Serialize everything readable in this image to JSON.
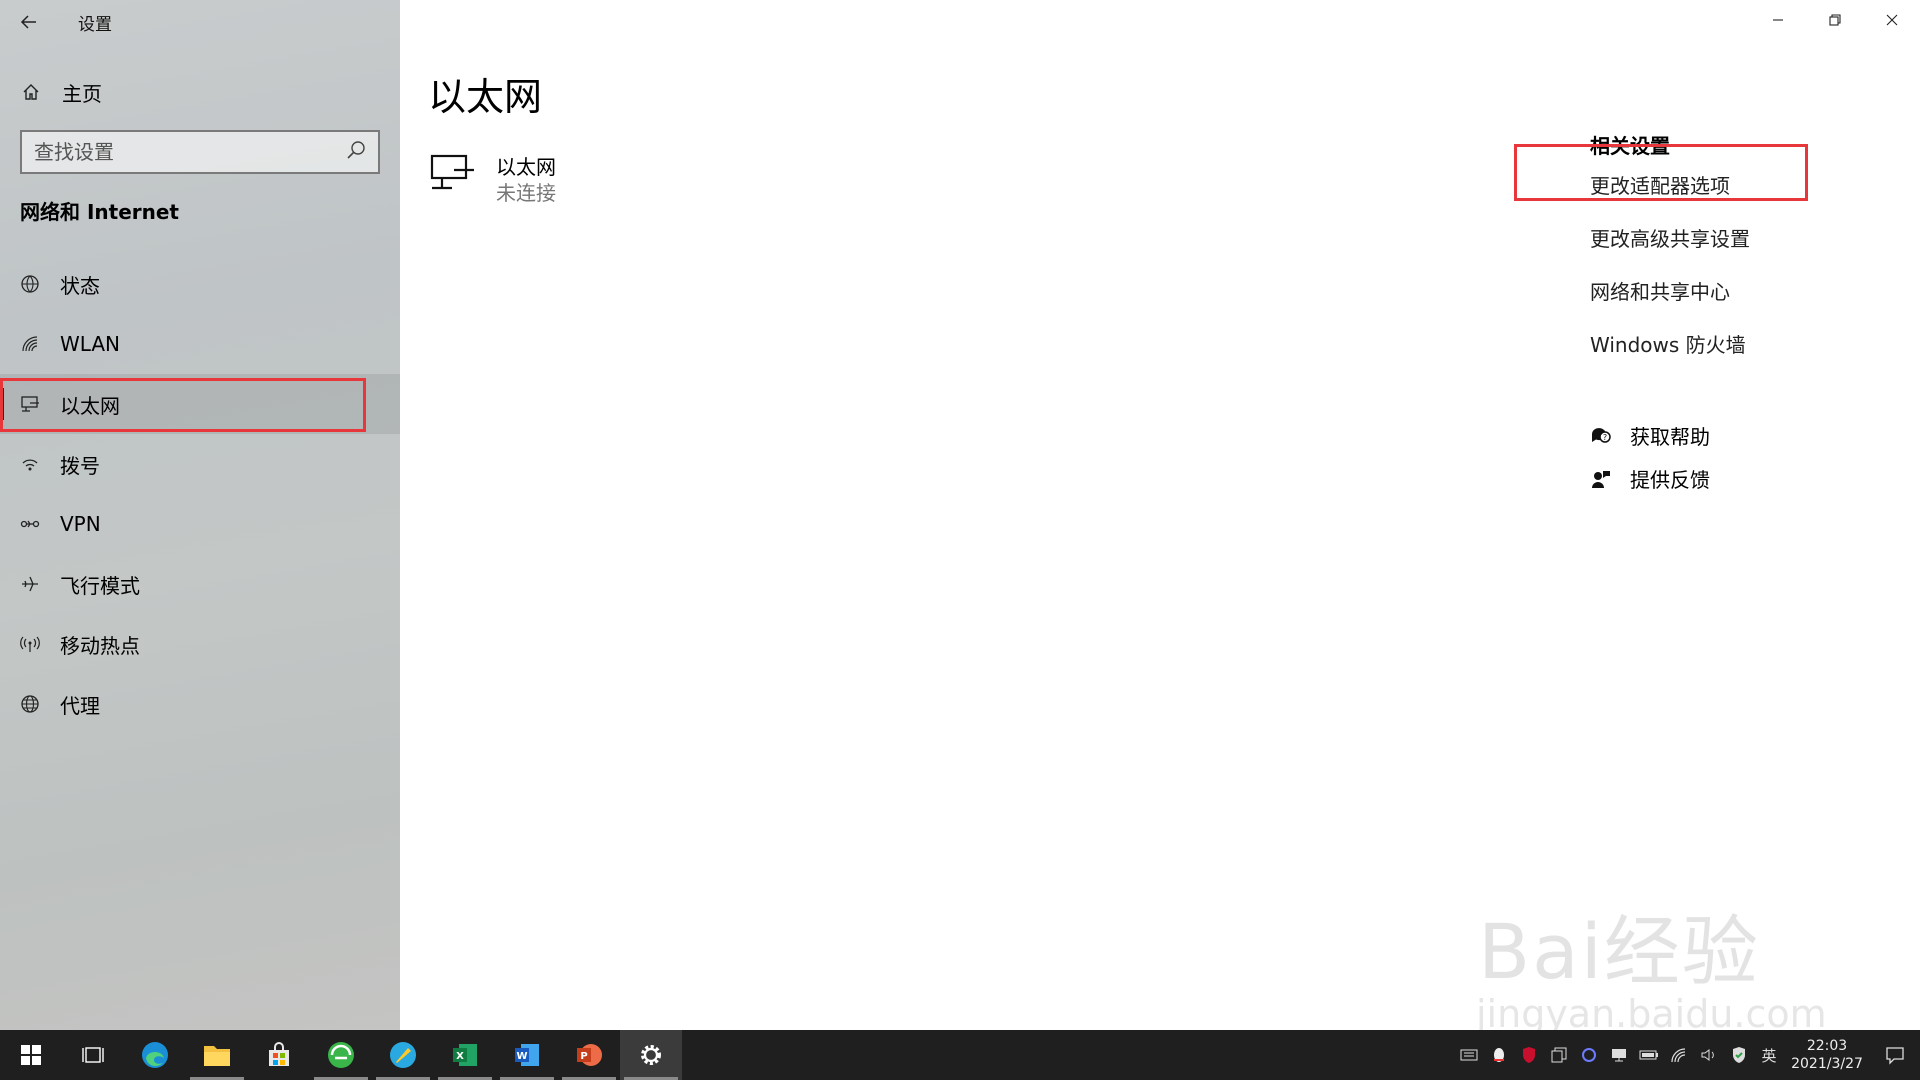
{
  "window": {
    "title": "设置",
    "controls": [
      "minimize",
      "restore",
      "close"
    ]
  },
  "sidebar": {
    "home_label": "主页",
    "search_placeholder": "查找设置",
    "section_title": "网络和 Internet",
    "items": [
      {
        "label": "状态",
        "icon": "status-globe-icon"
      },
      {
        "label": "WLAN",
        "icon": "wifi-icon"
      },
      {
        "label": "以太网",
        "icon": "ethernet-icon",
        "selected": true
      },
      {
        "label": "拨号",
        "icon": "dialup-icon"
      },
      {
        "label": "VPN",
        "icon": "vpn-icon"
      },
      {
        "label": "飞行模式",
        "icon": "airplane-icon"
      },
      {
        "label": "移动热点",
        "icon": "hotspot-icon"
      },
      {
        "label": "代理",
        "icon": "globe-icon"
      }
    ]
  },
  "main": {
    "page_title": "以太网",
    "ethernet": {
      "name": "以太网",
      "status": "未连接"
    },
    "related": {
      "title": "相关设置",
      "links": [
        "更改适配器选项",
        "更改高级共享设置",
        "网络和共享中心",
        "Windows 防火墙"
      ]
    },
    "help": [
      {
        "label": "获取帮助",
        "icon": "help-chat-icon"
      },
      {
        "label": "提供反馈",
        "icon": "feedback-icon"
      }
    ]
  },
  "watermark": {
    "text": "Bai经验",
    "sub": "jingyan.baidu.com"
  },
  "taskbar": {
    "apps": [
      "start",
      "task-view",
      "edge",
      "file-explorer",
      "store",
      "browser-360",
      "app-yellow",
      "excel",
      "word",
      "powerpoint",
      "settings"
    ],
    "tray": {
      "ime": "英",
      "time": "22:03",
      "date": "2021/3/27"
    }
  },
  "colors": {
    "highlight_border": "#e8373b",
    "taskbar": "#1f1f1f"
  }
}
